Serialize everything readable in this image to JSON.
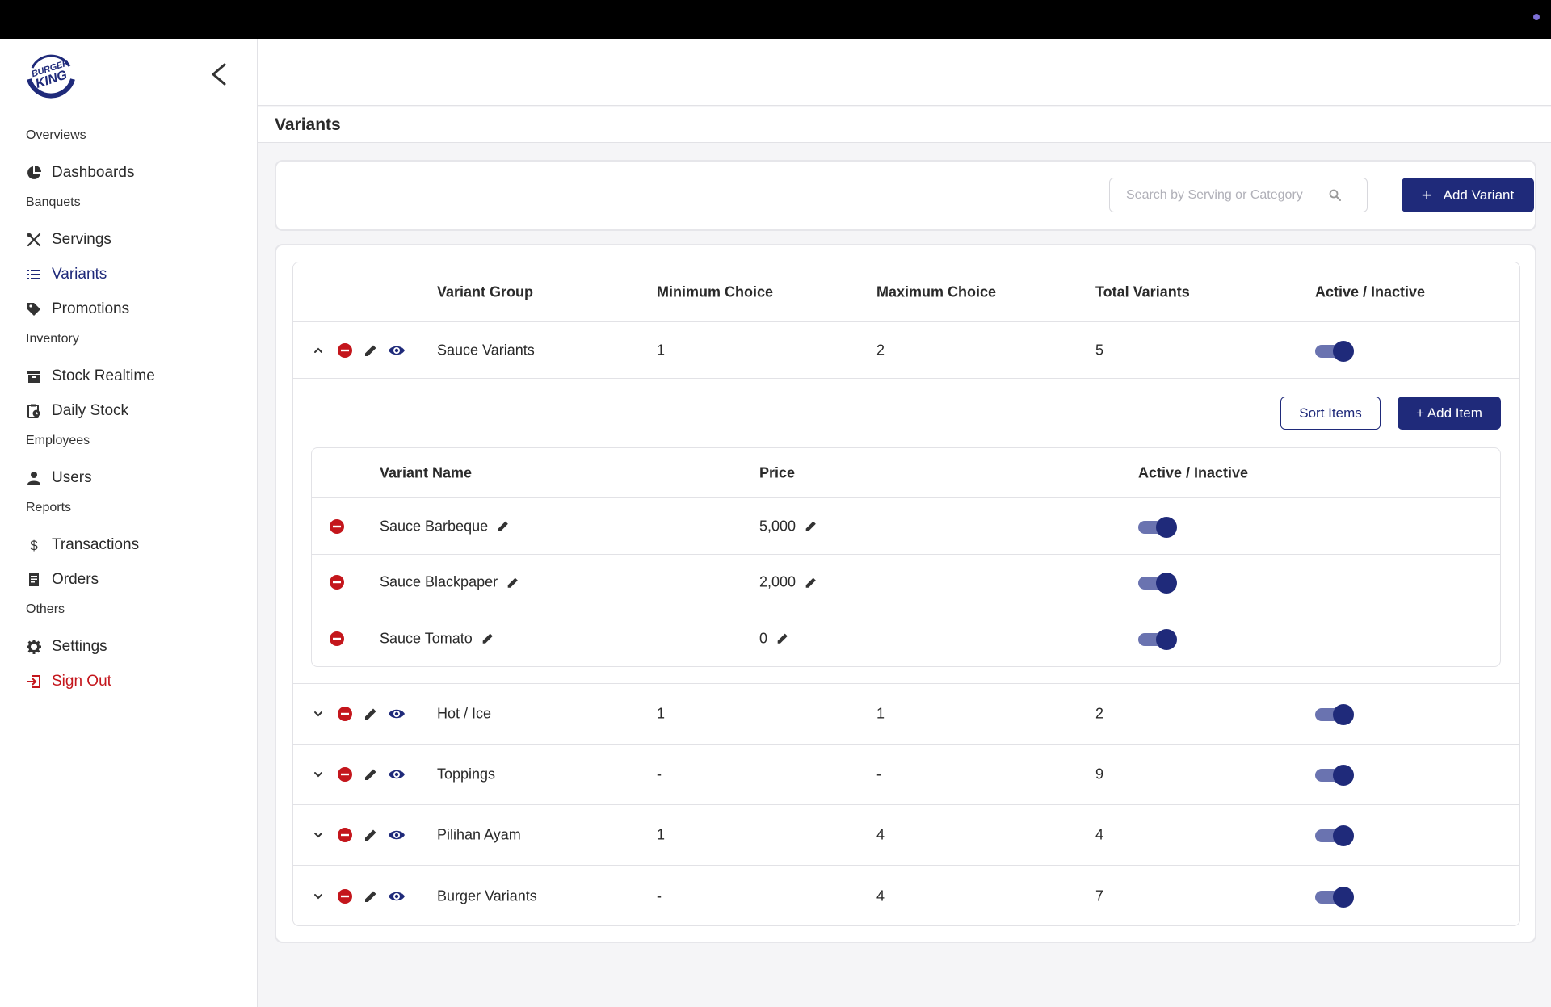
{
  "sidebar": {
    "logo_text": "BURGER KING",
    "sections": {
      "overviews": "Overviews",
      "banquets": "Banquets",
      "inventory": "Inventory",
      "employees": "Employees",
      "reports": "Reports",
      "others": "Others"
    },
    "items": {
      "dashboards": "Dashboards",
      "servings": "Servings",
      "variants": "Variants",
      "promotions": "Promotions",
      "stock_realtime": "Stock Realtime",
      "daily_stock": "Daily Stock",
      "users": "Users",
      "transactions": "Transactions",
      "orders": "Orders",
      "settings": "Settings",
      "sign_out": "Sign Out"
    },
    "active_item": "variants"
  },
  "page": {
    "title": "Variants"
  },
  "toolbar": {
    "search_placeholder": "Search by Serving or Category",
    "search_value": "",
    "add_variant_label": "Add Variant"
  },
  "table": {
    "headers": {
      "group": "Variant Group",
      "min": "Minimum Choice",
      "max": "Maximum Choice",
      "total": "Total Variants",
      "active": "Active / Inactive"
    },
    "rows": [
      {
        "group": "Sauce Variants",
        "min": "1",
        "max": "2",
        "total": "5",
        "active": true,
        "expanded": true
      },
      {
        "group": "Hot / Ice",
        "min": "1",
        "max": "1",
        "total": "2",
        "active": true,
        "expanded": false
      },
      {
        "group": "Toppings",
        "min": "-",
        "max": "-",
        "total": "9",
        "active": true,
        "expanded": false
      },
      {
        "group": "Pilihan Ayam",
        "min": "1",
        "max": "4",
        "total": "4",
        "active": true,
        "expanded": false
      },
      {
        "group": "Burger Variants",
        "min": "-",
        "max": "4",
        "total": "7",
        "active": true,
        "expanded": false
      }
    ]
  },
  "expanded": {
    "sort_label": "Sort Items",
    "add_item_label": "+ Add Item",
    "headers": {
      "name": "Variant Name",
      "price": "Price",
      "active": "Active / Inactive"
    },
    "items": [
      {
        "name": "Sauce Barbeque",
        "price": "5,000",
        "active": true
      },
      {
        "name": "Sauce Blackpaper",
        "price": "2,000",
        "active": true
      },
      {
        "name": "Sauce Tomato",
        "price": "0",
        "active": true
      }
    ]
  },
  "colors": {
    "brand": "#1f2a7a",
    "danger": "#c4161c",
    "toggle_track": "#6a73b0",
    "border": "#e2e2e6"
  },
  "icons": {
    "collapse": "chevron-left-icon",
    "dashboards": "pie-chart-icon",
    "servings": "utensils-icon",
    "variants": "list-icon",
    "promotions": "tag-icon",
    "stock_realtime": "archive-icon",
    "daily_stock": "clipboard-clock-icon",
    "users": "person-icon",
    "transactions": "dollar-icon",
    "orders": "receipt-icon",
    "settings": "gear-icon",
    "sign_out": "exit-icon",
    "search": "search-icon",
    "remove": "remove-circle-icon",
    "edit": "pencil-icon",
    "view": "eye-icon"
  }
}
